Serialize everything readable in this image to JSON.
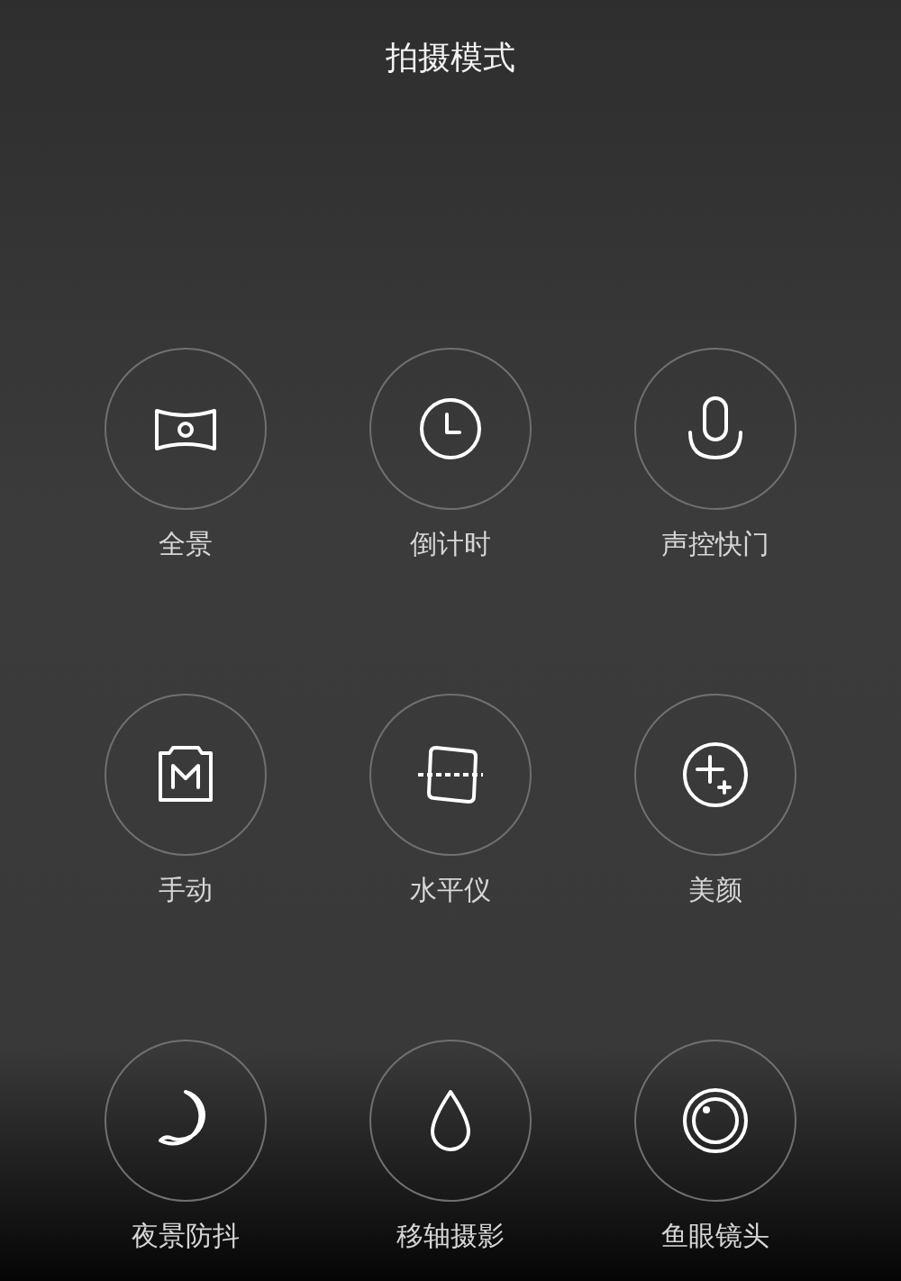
{
  "title": "拍摄模式",
  "modes": [
    {
      "label": "全景",
      "kind": "panorama"
    },
    {
      "label": "倒计时",
      "kind": "timer"
    },
    {
      "label": "声控快门",
      "kind": "voice"
    },
    {
      "label": "手动",
      "kind": "manual"
    },
    {
      "label": "水平仪",
      "kind": "level"
    },
    {
      "label": "美颜",
      "kind": "beauty"
    },
    {
      "label": "夜景防抖",
      "kind": "night"
    },
    {
      "label": "移轴摄影",
      "kind": "tiltshift"
    },
    {
      "label": "鱼眼镜头",
      "kind": "fisheye"
    }
  ]
}
